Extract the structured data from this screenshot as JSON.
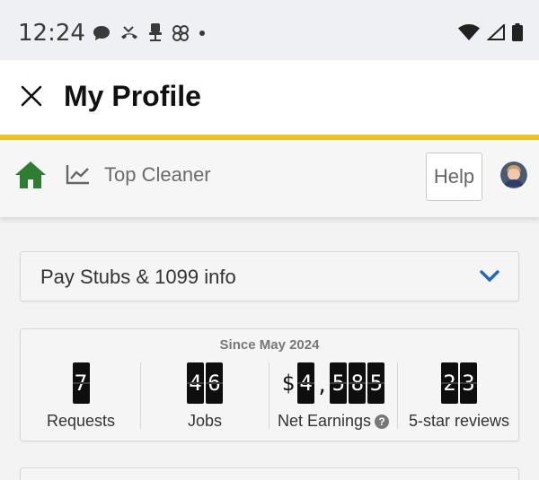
{
  "status_bar": {
    "time": "12:24",
    "left_icons": [
      "chat-bubble-icon",
      "missed-call-icon",
      "office-chair-icon",
      "pinwheel-icon",
      "dot-icon"
    ],
    "right_icons": [
      "wifi-icon",
      "cell-signal-icon",
      "battery-icon"
    ]
  },
  "header": {
    "title": "My Profile",
    "close_icon": "close-icon"
  },
  "navbar": {
    "home_icon": "home-icon",
    "chart_icon": "chart-trend-icon",
    "label": "Top Cleaner",
    "help_label": "Help",
    "avatar": "avatar"
  },
  "pay_stubs": {
    "label": "Pay Stubs & 1099 info",
    "chevron_icon": "chevron-down-icon"
  },
  "stats": {
    "since": "Since May 2024",
    "items": [
      {
        "value": "7",
        "label": "Requests"
      },
      {
        "value": "46",
        "label": "Jobs"
      },
      {
        "value": "$4,585",
        "label": "Net Earnings"
      },
      {
        "value": "23",
        "label": "5-star reviews"
      }
    ]
  },
  "colors": {
    "accent_yellow": "#f1c21b",
    "home_green": "#2f7d32",
    "chevron_blue": "#1e66c4"
  }
}
